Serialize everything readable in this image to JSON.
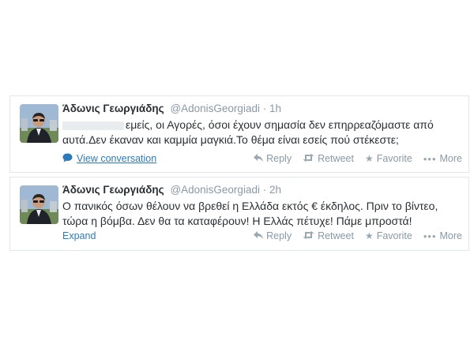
{
  "colors": {
    "link": "#2b7bb9",
    "muted": "#8899a6",
    "text": "#292f33",
    "border": "#e1e8ed"
  },
  "tweets": [
    {
      "name": "Άδωνις Γεωργιάδης",
      "handle": "@AdonisGeorgiadi",
      "separator": "·",
      "time": "1h",
      "text": "εμείς, οι Αγορές, όσοι έχουν σημασία δεν επηρρεαζόμαστε από αυτά.Δεν έκαναν και καμμία μαγκιά.Το θέμα είναι εσείς πού στέκεστε;",
      "expand_label": "View conversation",
      "expand_icon": "conversation-bubble-icon",
      "actions": [
        {
          "icon": "reply-icon",
          "label": "Reply"
        },
        {
          "icon": "retweet-icon",
          "label": "Retweet"
        },
        {
          "icon": "favorite-star-icon",
          "label": "Favorite"
        },
        {
          "icon": "more-dots-icon",
          "label": "More"
        }
      ]
    },
    {
      "name": "Άδωνις Γεωργιάδης",
      "handle": "@AdonisGeorgiadi",
      "separator": "·",
      "time": "2h",
      "text": "Ο πανικός όσων θέλουν να βρεθεί η Ελλάδα εκτός € έκδηλος. Πριν το βίντεο, τώρα η βόμβα. Δεν θα τα καταφέρουν! Η Ελλάς πέτυχε! Πάμε μπροστά!",
      "expand_label": "Expand",
      "actions": [
        {
          "icon": "reply-icon",
          "label": "Reply"
        },
        {
          "icon": "retweet-icon",
          "label": "Retweet"
        },
        {
          "icon": "favorite-star-icon",
          "label": "Favorite"
        },
        {
          "icon": "more-dots-icon",
          "label": "More"
        }
      ]
    }
  ]
}
